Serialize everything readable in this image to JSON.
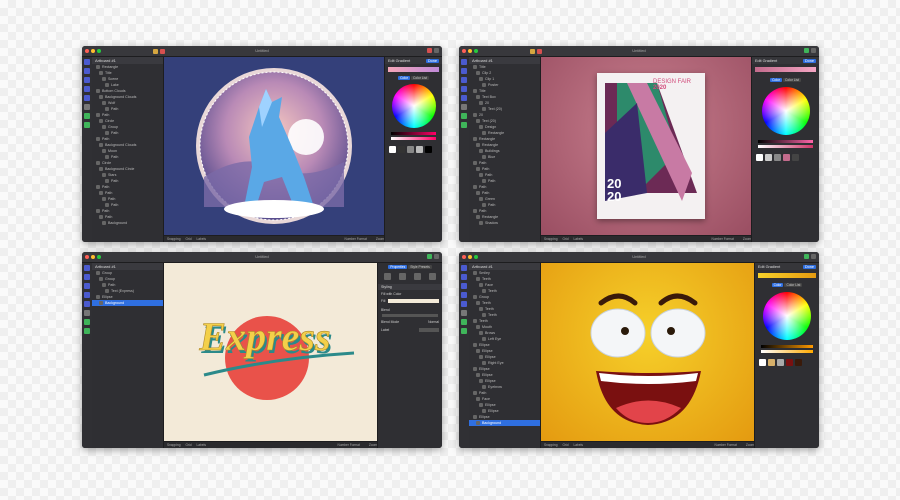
{
  "windows": [
    {
      "title": "Untitled",
      "artboard": "Artboard #1",
      "layers": [
        "Rectangle",
        "Title",
        "Scene",
        "Lake",
        "Bottom Clouds",
        "Background Clouds",
        "Wolf",
        "Path",
        "Path",
        "Circle",
        "Group",
        "Path",
        "Path",
        "Background Clouds",
        "Moon",
        "Path",
        "Circle",
        "Background Circle",
        "Stars",
        "Path",
        "Path",
        "Path",
        "Path",
        "Path",
        "Path",
        "Path",
        "Background"
      ],
      "status": {
        "snapping": "Snapping",
        "grid": "Grid",
        "labels": "Labels",
        "number_format": "Number Format",
        "zoom": "Zoom",
        "number_format_value": "Ns",
        "zoom_value": "75%"
      },
      "inspector": {
        "fill_title": "Edit Gradient",
        "done": "Done",
        "fill": "Fill",
        "gradient": "Gradient",
        "color": "Color",
        "color_list": "Color List"
      }
    },
    {
      "title": "Untitled",
      "artboard": "Artboard #1",
      "layers": [
        "Title",
        "Clip 2",
        "Clip 1",
        "Poster",
        "Title",
        "Text Box",
        "20",
        "Text (20)",
        "20",
        "Text (20)",
        "Design",
        "Rectangle",
        "Rectangle",
        "Rectangle",
        "Buildings",
        "Blue",
        "Path",
        "Path",
        "Path",
        "Path",
        "Path",
        "Path",
        "Green",
        "Path",
        "Path",
        "Rectangle",
        "Shadow"
      ],
      "poster": {
        "title": "DESIGN FAIR",
        "year": "2020",
        "big1": "20",
        "big2": "20"
      },
      "status": {
        "snapping": "Snapping",
        "grid": "Grid",
        "labels": "Labels",
        "number_format": "Number Format",
        "zoom": "Zoom",
        "number_format_value": "Ns",
        "zoom_value": "75%"
      },
      "inspector": {
        "fill_title": "Edit Gradient",
        "done": "Done",
        "fill": "Fill",
        "gradient": "Gradient",
        "color": "Color",
        "color_list": "Color List"
      }
    },
    {
      "title": "Untitled",
      "artboard": "Artboard #1",
      "layers": [
        "Group",
        "Group",
        "Path",
        "Text (Express)",
        "Ellipse",
        "Background"
      ],
      "text": "Express",
      "status": {
        "snapping": "Snapping",
        "grid": "Grid",
        "labels": "Labels",
        "number_format": "Number Format",
        "zoom": "Zoom",
        "number_format_value": "Ns",
        "zoom_value": "75%"
      },
      "inspector": {
        "tab1": "Properties",
        "tab2": "Style Presets",
        "styling": "Styling",
        "row1": "Fill with Color",
        "fill": "Fill",
        "blend": "Blend",
        "blend_mode": "Blend Mode",
        "label": "Label",
        "normal": "Normal"
      }
    },
    {
      "title": "Untitled",
      "artboard": "Artboard #1",
      "layers": [
        "Smiley",
        "Teeth",
        "Face",
        "Teeth",
        "Group",
        "Teeth",
        "Teeth",
        "Teeth",
        "Teeth",
        "Mouth",
        "Brows",
        "Left Eye",
        "Ellipse",
        "Ellipse",
        "Ellipse",
        "Right Eye",
        "Ellipse",
        "Ellipse",
        "Ellipse",
        "Eyebrow",
        "Path",
        "Face",
        "Ellipse",
        "Ellipse",
        "Ellipse",
        "Background"
      ],
      "status": {
        "snapping": "Snapping",
        "grid": "Grid",
        "labels": "Labels",
        "number_format": "Number Format",
        "zoom": "Zoom",
        "number_format_value": "Ns",
        "zoom_value": "75%"
      },
      "inspector": {
        "fill_title": "Edit Gradient",
        "done": "Done",
        "fill": "Fill",
        "gradient": "Gradient",
        "color": "Color",
        "color_list": "Color List"
      }
    }
  ],
  "icons": [
    "app-icon",
    "undo-icon",
    "redo-icon",
    "rectangle-tool-icon",
    "text-tool-icon",
    "pen-tool-icon",
    "layers-icon",
    "eyedropper-icon",
    "share-icon"
  ],
  "colors": {
    "accent": "#2f6fe0",
    "panel": "#2f2f33",
    "titlebar": "#38383c"
  }
}
